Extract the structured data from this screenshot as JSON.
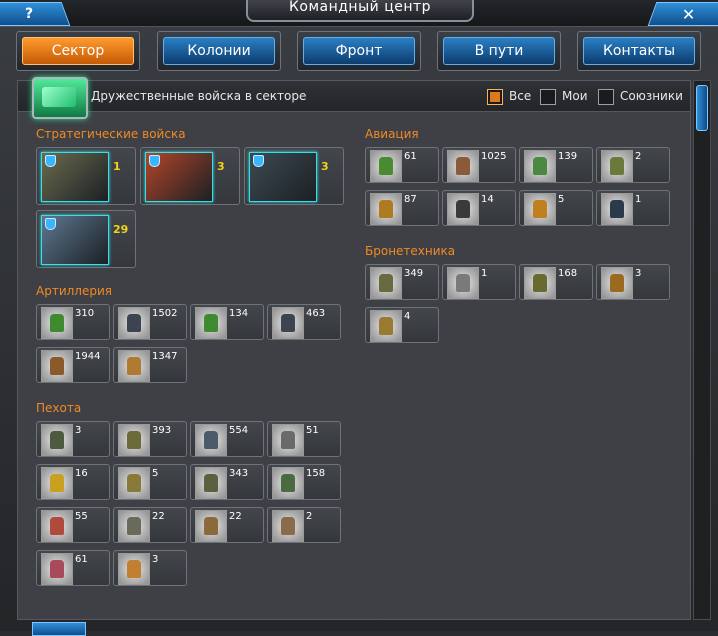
{
  "window": {
    "title": "Командный центр",
    "help_label": "?",
    "close_label": "✕"
  },
  "tabs": [
    {
      "label": "Сектор",
      "active": true
    },
    {
      "label": "Колонии",
      "active": false
    },
    {
      "label": "Фронт",
      "active": false
    },
    {
      "label": "В пути",
      "active": false
    },
    {
      "label": "Контакты",
      "active": false
    }
  ],
  "filter": {
    "title": "Дружественные войска в секторе",
    "options": [
      {
        "label": "Все",
        "checked": true
      },
      {
        "label": "Мои",
        "checked": false
      },
      {
        "label": "Союзники",
        "checked": false
      }
    ]
  },
  "groups": {
    "strategic": {
      "title": "Стратегические войска",
      "units": [
        {
          "count": "1",
          "color": "#6b6b4e"
        },
        {
          "count": "3",
          "color": "#b3452a"
        },
        {
          "count": "3",
          "color": "#3d4a52"
        },
        {
          "count": "29",
          "color": "#5d7890"
        }
      ]
    },
    "artillery": {
      "title": "Артиллерия",
      "units": [
        {
          "count": "310",
          "color": "#3f8a2e"
        },
        {
          "count": "1502",
          "color": "#3b4450"
        },
        {
          "count": "134",
          "color": "#3f8a2e"
        },
        {
          "count": "463",
          "color": "#3b4450"
        },
        {
          "count": "1944",
          "color": "#8a5a2a"
        },
        {
          "count": "1347",
          "color": "#b07a30"
        }
      ]
    },
    "infantry": {
      "title": "Пехота",
      "units": [
        {
          "count": "3",
          "color": "#4d5a40"
        },
        {
          "count": "393",
          "color": "#6a6a3a"
        },
        {
          "count": "554",
          "color": "#4a5a6a"
        },
        {
          "count": "51",
          "color": "#6a6a6a"
        },
        {
          "count": "16",
          "color": "#c9a020"
        },
        {
          "count": "5",
          "color": "#8a7a3a"
        },
        {
          "count": "343",
          "color": "#5a6040"
        },
        {
          "count": "158",
          "color": "#4a6a40"
        },
        {
          "count": "55",
          "color": "#b04a3a"
        },
        {
          "count": "22",
          "color": "#6a6a5a"
        },
        {
          "count": "22",
          "color": "#8a6a3a"
        },
        {
          "count": "2",
          "color": "#8a6a4a"
        },
        {
          "count": "61",
          "color": "#a84a5a"
        },
        {
          "count": "3",
          "color": "#c08030"
        }
      ]
    },
    "aviation": {
      "title": "Авиация",
      "units": [
        {
          "count": "61",
          "color": "#4a8a30"
        },
        {
          "count": "1025",
          "color": "#8a5a3a"
        },
        {
          "count": "139",
          "color": "#4a8a40"
        },
        {
          "count": "2",
          "color": "#6a7a3a"
        },
        {
          "count": "87",
          "color": "#b07a20"
        },
        {
          "count": "14",
          "color": "#3a3a3a"
        },
        {
          "count": "5",
          "color": "#c08020"
        },
        {
          "count": "1",
          "color": "#2a3a4a"
        }
      ]
    },
    "armor": {
      "title": "Бронетехника",
      "units": [
        {
          "count": "349",
          "color": "#6a6a40"
        },
        {
          "count": "1",
          "color": "#7a7a7a"
        },
        {
          "count": "168",
          "color": "#6a6a30"
        },
        {
          "count": "3",
          "color": "#9a6a20"
        },
        {
          "count": "4",
          "color": "#9a7a30"
        }
      ]
    }
  }
}
